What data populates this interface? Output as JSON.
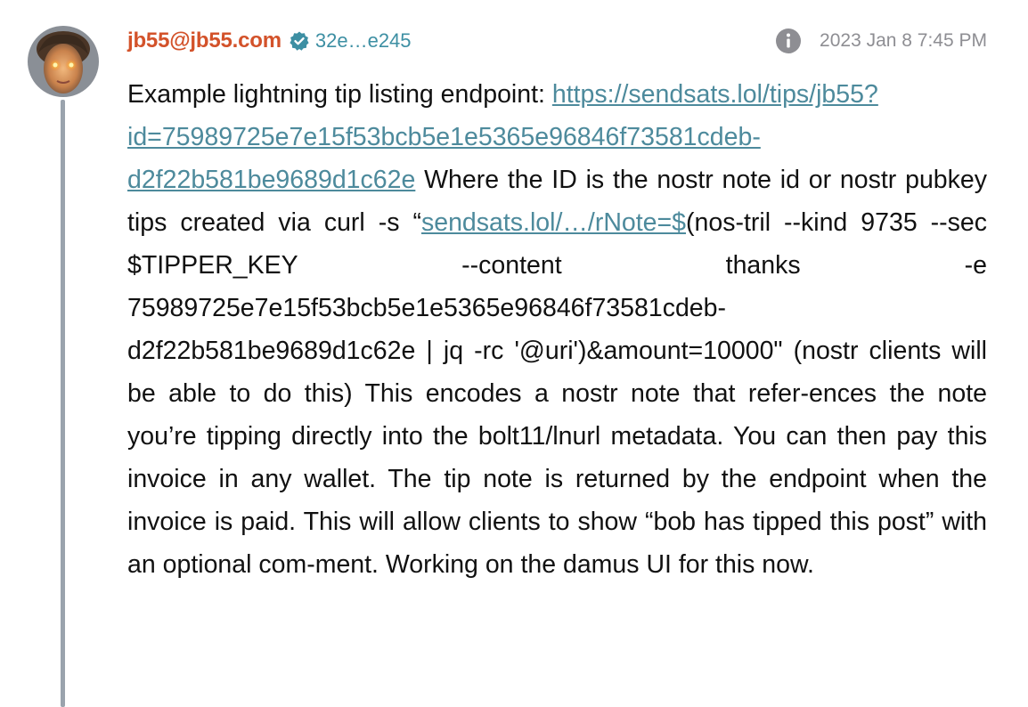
{
  "note": {
    "author": {
      "name": "jb55@jb55.com",
      "pubkey_short": "32e…e245",
      "verified_icon": "verified-badge-icon",
      "avatar_icon": "avatar"
    },
    "info_icon": "info-icon",
    "timestamp": "2023 Jan 8 7:45 PM",
    "content": {
      "p1": "Example lightning tip listing endpoint: ",
      "link1_a": "https://sendsats.lol/tips/jb55?",
      "link1_b": "id=75989725e7e15f53bcb5e1e5365e96846f73581cdeb-",
      "link1_c": "d2f22b581be9689d1c62e",
      "p2": " Where the ID is the nostr note id or nostr pubkey tips created via curl -s “",
      "link2": "sendsats.lol/…/rNote=$",
      "p3": "(nos-tril --kind 9735 --sec $TIPPER_KEY --content thanks -e 75989725e7e15f53bcb5e1e5365e96846f73581cdeb-d2f22b581be9689d1c62e | jq -rc '@uri')&amount=10000\" (nostr clients will be able to do this) This encodes a nostr note that refer-ences the note you’re tipping directly into the bolt11/lnurl metadata. You can then pay this invoice in any wallet. The tip note is returned by the endpoint when the invoice is paid. This will allow clients to show “bob has tipped this post” with an optional com-ment. Working on the damus UI for this now."
    }
  },
  "colors": {
    "author": "#d3522a",
    "pubkey": "#3d8fa3",
    "link": "#4d8a9c",
    "timestamp": "#8e8e93",
    "thread_line": "#9aa3ad"
  }
}
